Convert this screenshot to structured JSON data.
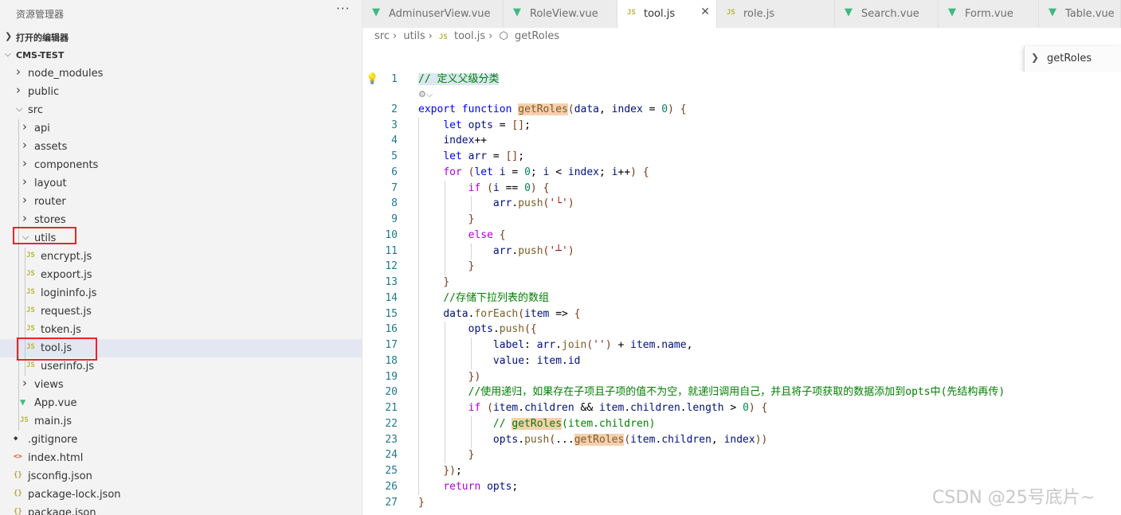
{
  "sidebar": {
    "title": "资源管理器",
    "more_icon": "ellipsis-icon",
    "open_editors_label": "打开的编辑器",
    "project_label": "CMS-TEST",
    "tree": [
      {
        "label": "node_modules",
        "kind": "folder",
        "expanded": false
      },
      {
        "label": "public",
        "kind": "folder",
        "expanded": false
      },
      {
        "label": "src",
        "kind": "folder",
        "expanded": true
      },
      {
        "label": "api",
        "kind": "folder",
        "expanded": false
      },
      {
        "label": "assets",
        "kind": "folder",
        "expanded": false
      },
      {
        "label": "components",
        "kind": "folder",
        "expanded": false
      },
      {
        "label": "layout",
        "kind": "folder",
        "expanded": false
      },
      {
        "label": "router",
        "kind": "folder",
        "expanded": false
      },
      {
        "label": "stores",
        "kind": "folder",
        "expanded": false
      },
      {
        "label": "utils",
        "kind": "folder",
        "expanded": true
      },
      {
        "label": "encrypt.js",
        "kind": "js"
      },
      {
        "label": "expoort.js",
        "kind": "js"
      },
      {
        "label": "logininfo.js",
        "kind": "js"
      },
      {
        "label": "request.js",
        "kind": "js"
      },
      {
        "label": "token.js",
        "kind": "js"
      },
      {
        "label": "tool.js",
        "kind": "js",
        "selected": true
      },
      {
        "label": "userinfo.js",
        "kind": "js"
      },
      {
        "label": "views",
        "kind": "folder",
        "expanded": false
      },
      {
        "label": "App.vue",
        "kind": "vue"
      },
      {
        "label": "main.js",
        "kind": "js"
      },
      {
        "label": ".gitignore",
        "kind": "git"
      },
      {
        "label": "index.html",
        "kind": "html"
      },
      {
        "label": "jsconfig.json",
        "kind": "json"
      },
      {
        "label": "package-lock.json",
        "kind": "json"
      },
      {
        "label": "package.json",
        "kind": "json"
      }
    ]
  },
  "tabs": [
    {
      "label": "AdminuserView.vue",
      "kind": "vue"
    },
    {
      "label": "RoleView.vue",
      "kind": "vue"
    },
    {
      "label": "tool.js",
      "kind": "js",
      "active": true
    },
    {
      "label": "role.js",
      "kind": "js"
    },
    {
      "label": "Search.vue",
      "kind": "vue"
    },
    {
      "label": "Form.vue",
      "kind": "vue"
    },
    {
      "label": "Table.vue",
      "kind": "vue"
    }
  ],
  "breadcrumb": [
    "src",
    "utils",
    "tool.js",
    "getRoles"
  ],
  "sticky_scroll": "getRoles",
  "editor": {
    "lines": [
      "// 定义父级分类",
      "export function getRoles(data, index = 0) {",
      "    let opts = [];",
      "    index++",
      "    let arr = [];",
      "    for (let i = 0; i < index; i++) {",
      "        if (i == 0) {",
      "            arr.push('└')",
      "        }",
      "        else {",
      "            arr.push('┴')",
      "        }",
      "    }",
      "    //存储下拉列表的数组",
      "    data.forEach(item => {",
      "        opts.push({",
      "            label: arr.join('') + item.name,",
      "            value: item.id",
      "        })",
      "        //使用递归，如果存在子项且子项的值不为空，就递归调用自己，并且将子项获取的数据添加到opts中(先结构再传)",
      "        if (item.children && item.children.length > 0) {",
      "            // getRoles(item.children)",
      "            opts.push(...getRoles(item.children, index))",
      "        }",
      "    });",
      "    return opts;",
      "}"
    ]
  },
  "watermark": "CSDN @25号底片~",
  "colors": {
    "keyword": "#0000ff",
    "control": "#af00db",
    "function": "#795e26",
    "variable": "#001080",
    "number": "#098658",
    "string": "#a31515",
    "comment": "#008000",
    "highlight": "#f8cfae",
    "selection": "#e4e6f1",
    "annotation_box": "#e8262b"
  }
}
